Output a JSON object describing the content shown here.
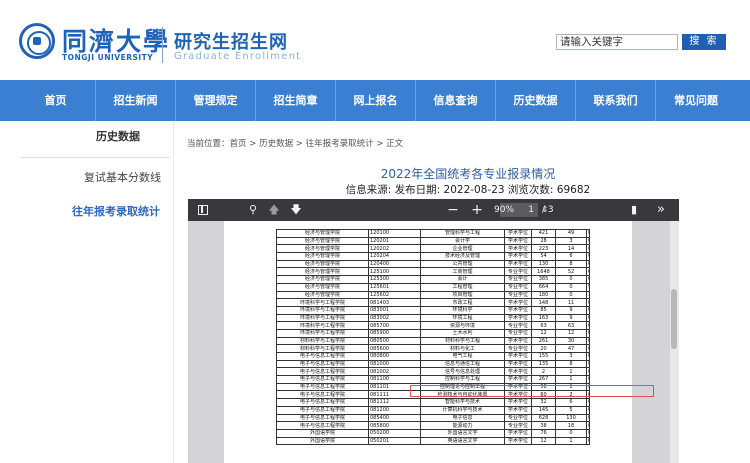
{
  "header": {
    "logo_cn": "同濟大學",
    "logo_en": "TONGJI UNIVERSITY",
    "site_title": "研究生招生网",
    "site_subtitle": "Graduate Enrollment",
    "search_placeholder": "请输入关键字",
    "search_button": "搜 索"
  },
  "nav": [
    "首页",
    "招生新闻",
    "管理规定",
    "招生简章",
    "网上报名",
    "信息查询",
    "历史数据",
    "联系我们",
    "常见问题"
  ],
  "sidebar": {
    "title": "历史数据",
    "items": [
      "复试基本分数线",
      "往年报考录取统计"
    ]
  },
  "breadcrumb": {
    "prefix": "当前位置：",
    "items": [
      "首页",
      "历史数据",
      "往年报考录取统计",
      "正文"
    ],
    "sep": " > "
  },
  "article": {
    "title": "2022年全国统考各专业报录情况",
    "meta": "信息来源:   发布日期: 2022-08-23 浏览次数: 69682"
  },
  "pdf": {
    "page_current": "1",
    "page_total": "/ 3",
    "zoom": "90%",
    "rows": [
      [
        "经济与管理学院",
        "120100",
        "管理科学与工程",
        "学术学位",
        "421",
        "49",
        "0"
      ],
      [
        "经济与管理学院",
        "120201",
        "会计学",
        "学术学位",
        "28",
        "3",
        "0"
      ],
      [
        "经济与管理学院",
        "120202",
        "企业管理",
        "学术学位",
        "223",
        "14",
        "0"
      ],
      [
        "经济与管理学院",
        "120204",
        "技术经济及管理",
        "学术学位",
        "54",
        "6",
        "0"
      ],
      [
        "经济与管理学院",
        "120400",
        "公共管理",
        "学术学位",
        "130",
        "8",
        "0"
      ],
      [
        "经济与管理学院",
        "125100",
        "工商管理",
        "专业学位",
        "1648",
        "52",
        "665"
      ],
      [
        "经济与管理学院",
        "125300",
        "会计",
        "专业学位",
        "385",
        "0",
        "61"
      ],
      [
        "经济与管理学院",
        "125601",
        "工程管理",
        "专业学位",
        "664",
        "0",
        "91"
      ],
      [
        "经济与管理学院",
        "125602",
        "项目管理",
        "专业学位",
        "180",
        "0",
        "32"
      ],
      [
        "环境科学与工程学院",
        "081403",
        "市政工程",
        "学术学位",
        "148",
        "11",
        "0"
      ],
      [
        "环境科学与工程学院",
        "083001",
        "环境科学",
        "学术学位",
        "85",
        "9",
        "0"
      ],
      [
        "环境科学与工程学院",
        "083002",
        "环境工程",
        "学术学位",
        "163",
        "9",
        "0"
      ],
      [
        "环境科学与工程学院",
        "085700",
        "资源与环境",
        "专业学位",
        "63",
        "63",
        "0"
      ],
      [
        "环境科学与工程学院",
        "085900",
        "土木水利",
        "专业学位",
        "12",
        "12",
        "0"
      ],
      [
        "材料科学与工程学院",
        "080500",
        "材料科学与工程",
        "学术学位",
        "261",
        "30",
        "0"
      ],
      [
        "材料科学与工程学院",
        "085600",
        "材料与化工",
        "专业学位",
        "20",
        "47",
        "0"
      ],
      [
        "电子与信息工程学院",
        "080800",
        "电气工程",
        "学术学位",
        "155",
        "3",
        "0"
      ],
      [
        "电子与信息工程学院",
        "081000",
        "信息与通信工程",
        "学术学位",
        "135",
        "8",
        "0"
      ],
      [
        "电子与信息工程学院",
        "081002",
        "信号与信息处理",
        "学术学位",
        "2",
        "1",
        "0"
      ],
      [
        "电子与信息工程学院",
        "081100",
        "控制科学与工程",
        "学术学位",
        "267",
        "1",
        "0"
      ],
      [
        "电子与信息工程学院",
        "081101",
        "控制理论与控制工程",
        "学术学位",
        "58",
        "1",
        "0"
      ],
      [
        "电子与信息工程学院",
        "081111",
        "检测技术与自动化装置",
        "学术学位",
        "60",
        "2",
        "0"
      ],
      [
        "电子与信息工程学院",
        "081112",
        "智能科学与技术",
        "学术学位",
        "32",
        "6",
        "0"
      ],
      [
        "电子与信息工程学院",
        "081200",
        "计算机科学与技术",
        "学术学位",
        "145",
        "5",
        "0"
      ],
      [
        "电子与信息工程学院",
        "085400",
        "电子信息",
        "专业学位",
        "628",
        "130",
        "0"
      ],
      [
        "电子与信息工程学院",
        "085800",
        "能源动力",
        "专业学位",
        "38",
        "18",
        "0"
      ],
      [
        "外国语学院",
        "050200",
        "外国语言文学",
        "学术学位",
        "76",
        "0",
        "0"
      ],
      [
        "外国语学院",
        "050201",
        "英语语言文学",
        "学术学位",
        "12",
        "1",
        "0"
      ]
    ]
  }
}
